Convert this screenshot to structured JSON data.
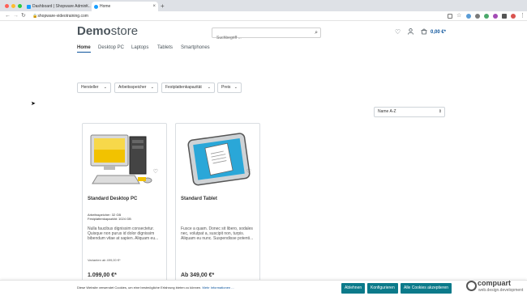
{
  "browser": {
    "tabs": [
      {
        "title": "Dashboard | Shopware Admini..."
      },
      {
        "title": "Home"
      }
    ],
    "url": "shopware-videotraining.com",
    "colors": {
      "close": "#ff5f57",
      "minimize": "#febc2e",
      "maximize": "#28c840"
    }
  },
  "header": {
    "logo_bold": "Demo",
    "logo_light": "store",
    "search_placeholder": "Suchbegriff ...",
    "cart_total": "0,00 €*"
  },
  "nav": {
    "items": [
      "Home",
      "Desktop PC",
      "Laptops",
      "Tablets",
      "Smartphones"
    ]
  },
  "filters": {
    "items": [
      "Hersteller",
      "Arbeitsspeicher",
      "Festplattenkapazität",
      "Preis"
    ],
    "sort_value": "Name A-Z"
  },
  "products": [
    {
      "name": "Standard Desktop PC",
      "props_line1": "Arbeitsspeicher:   32   GB",
      "props_line2": "Festplattenkapazität: 1024 GB",
      "description": "Nulla faucibus dignissim consectetur. Quisque non purus id dolor dignissim bibendum vitae at sapien. Aliquam eu...",
      "variant_note": "Varianten ab 499,00 €*",
      "price": "1.099,00 €*"
    },
    {
      "name": "Standard Tablet",
      "props_line1": "",
      "props_line2": "",
      "description": "Fusce a quam. Donec sit libero, sodales nec, volutpat a, suscipit non, turpis. Aliquam eu nunc. Suspendisse potenti...",
      "variant_note": "",
      "price": "Ab 349,00 €*"
    }
  ],
  "cookie": {
    "text": "Diese Website verwendet Cookies, um eine bestmögliche Erfahrung bieten zu können.",
    "link": "Mehr Informationen ...",
    "reject": "Ablehnen",
    "configure": "Konfigurieren",
    "accept_all": "Alle Cookies akzeptieren",
    "accent": "#0b7a8a"
  },
  "watermark": {
    "name": "compuart",
    "sub": "web.design.development"
  }
}
